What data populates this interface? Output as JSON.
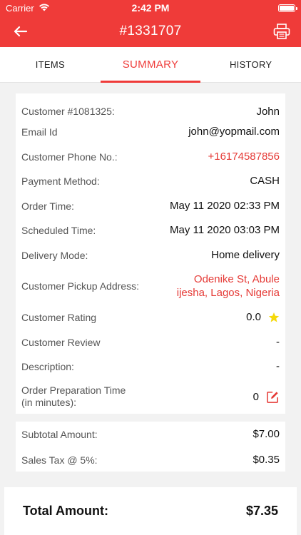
{
  "status_bar": {
    "carrier": "Carrier",
    "time": "2:42 PM"
  },
  "header": {
    "title": "#1331707",
    "back_icon": "arrow-left-icon",
    "print_icon": "printer-icon"
  },
  "tabs": [
    {
      "label": "ITEMS",
      "active": false
    },
    {
      "label": "SUMMARY",
      "active": true
    },
    {
      "label": "HISTORY",
      "active": false
    }
  ],
  "details": {
    "customer_label": "Customer #1081325:",
    "customer_value": "John",
    "email_label": "Email Id",
    "email_value": "john@yopmail.com",
    "phone_label": "Customer Phone No.:",
    "phone_value": "+16174587856",
    "payment_label": "Payment Method:",
    "payment_value": "CASH",
    "order_time_label": "Order Time:",
    "order_time_value": "May 11 2020 02:33 PM",
    "scheduled_label": "Scheduled Time:",
    "scheduled_value": "May 11 2020 03:03 PM",
    "delivery_label": "Delivery Mode:",
    "delivery_value": "Home delivery",
    "pickup_label": "Customer Pickup Address:",
    "pickup_line1": "Odenike St, Abule",
    "pickup_line2": "ijesha, Lagos, Nigeria",
    "rating_label": "Customer Rating",
    "rating_value": "0.0",
    "review_label": "Customer Review",
    "review_value": "-",
    "description_label": "Description:",
    "description_value": "-",
    "prep_label_line1": "Order Preparation Time",
    "prep_label_line2": "(in minutes):",
    "prep_value": "0"
  },
  "amounts": {
    "subtotal_label": "Subtotal Amount:",
    "subtotal_value": "$7.00",
    "tax_label": "Sales Tax @ 5%:",
    "tax_value": "$0.35"
  },
  "total": {
    "label": "Total Amount:",
    "value": "$7.35"
  },
  "colors": {
    "accent": "#ef3b39",
    "star": "#f5d90a",
    "link": "#e53935"
  }
}
